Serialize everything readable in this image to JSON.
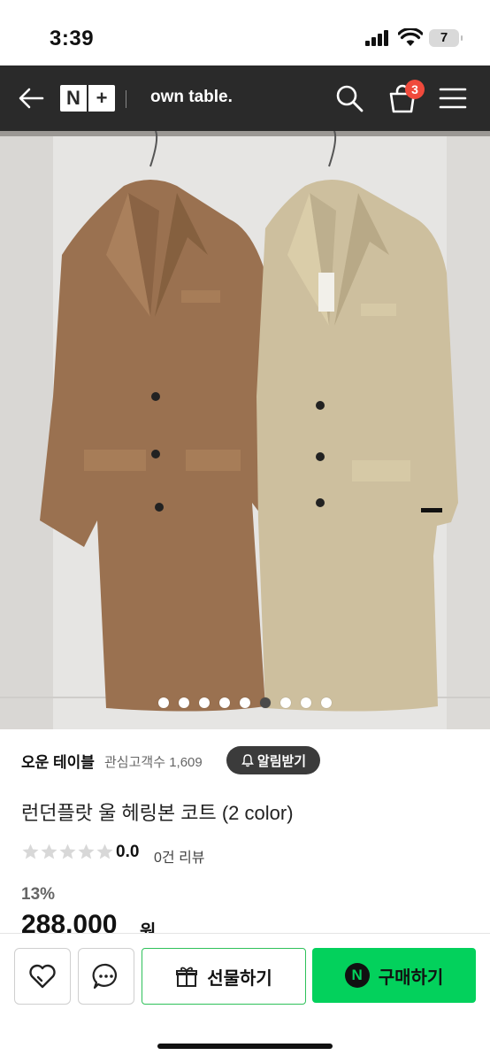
{
  "status_bar": {
    "time": "3:39",
    "battery": "7"
  },
  "nav": {
    "logo_n": "N",
    "logo_plus": "+",
    "store_name": "own table.",
    "cart_count": "3"
  },
  "carousel": {
    "dot_count": 9,
    "active_index": 5
  },
  "product": {
    "store": "오운 테이블",
    "fans_label": "관심고객수",
    "fans_count": "1,609",
    "alert_label": "알림받기",
    "title": "런던플랏 울 헤링본 코트 (2 color)",
    "rating": "0.0",
    "reviews": "0건 리뷰",
    "discount": "13%",
    "price": "288,000",
    "currency": "원"
  },
  "actions": {
    "gift_label": "선물하기",
    "buy_label": "구매하기",
    "buy_icon_letter": "N"
  },
  "colors": {
    "brand_green": "#03d15c",
    "navbar": "#2a2a2a",
    "badge_red": "#f04a3c"
  }
}
